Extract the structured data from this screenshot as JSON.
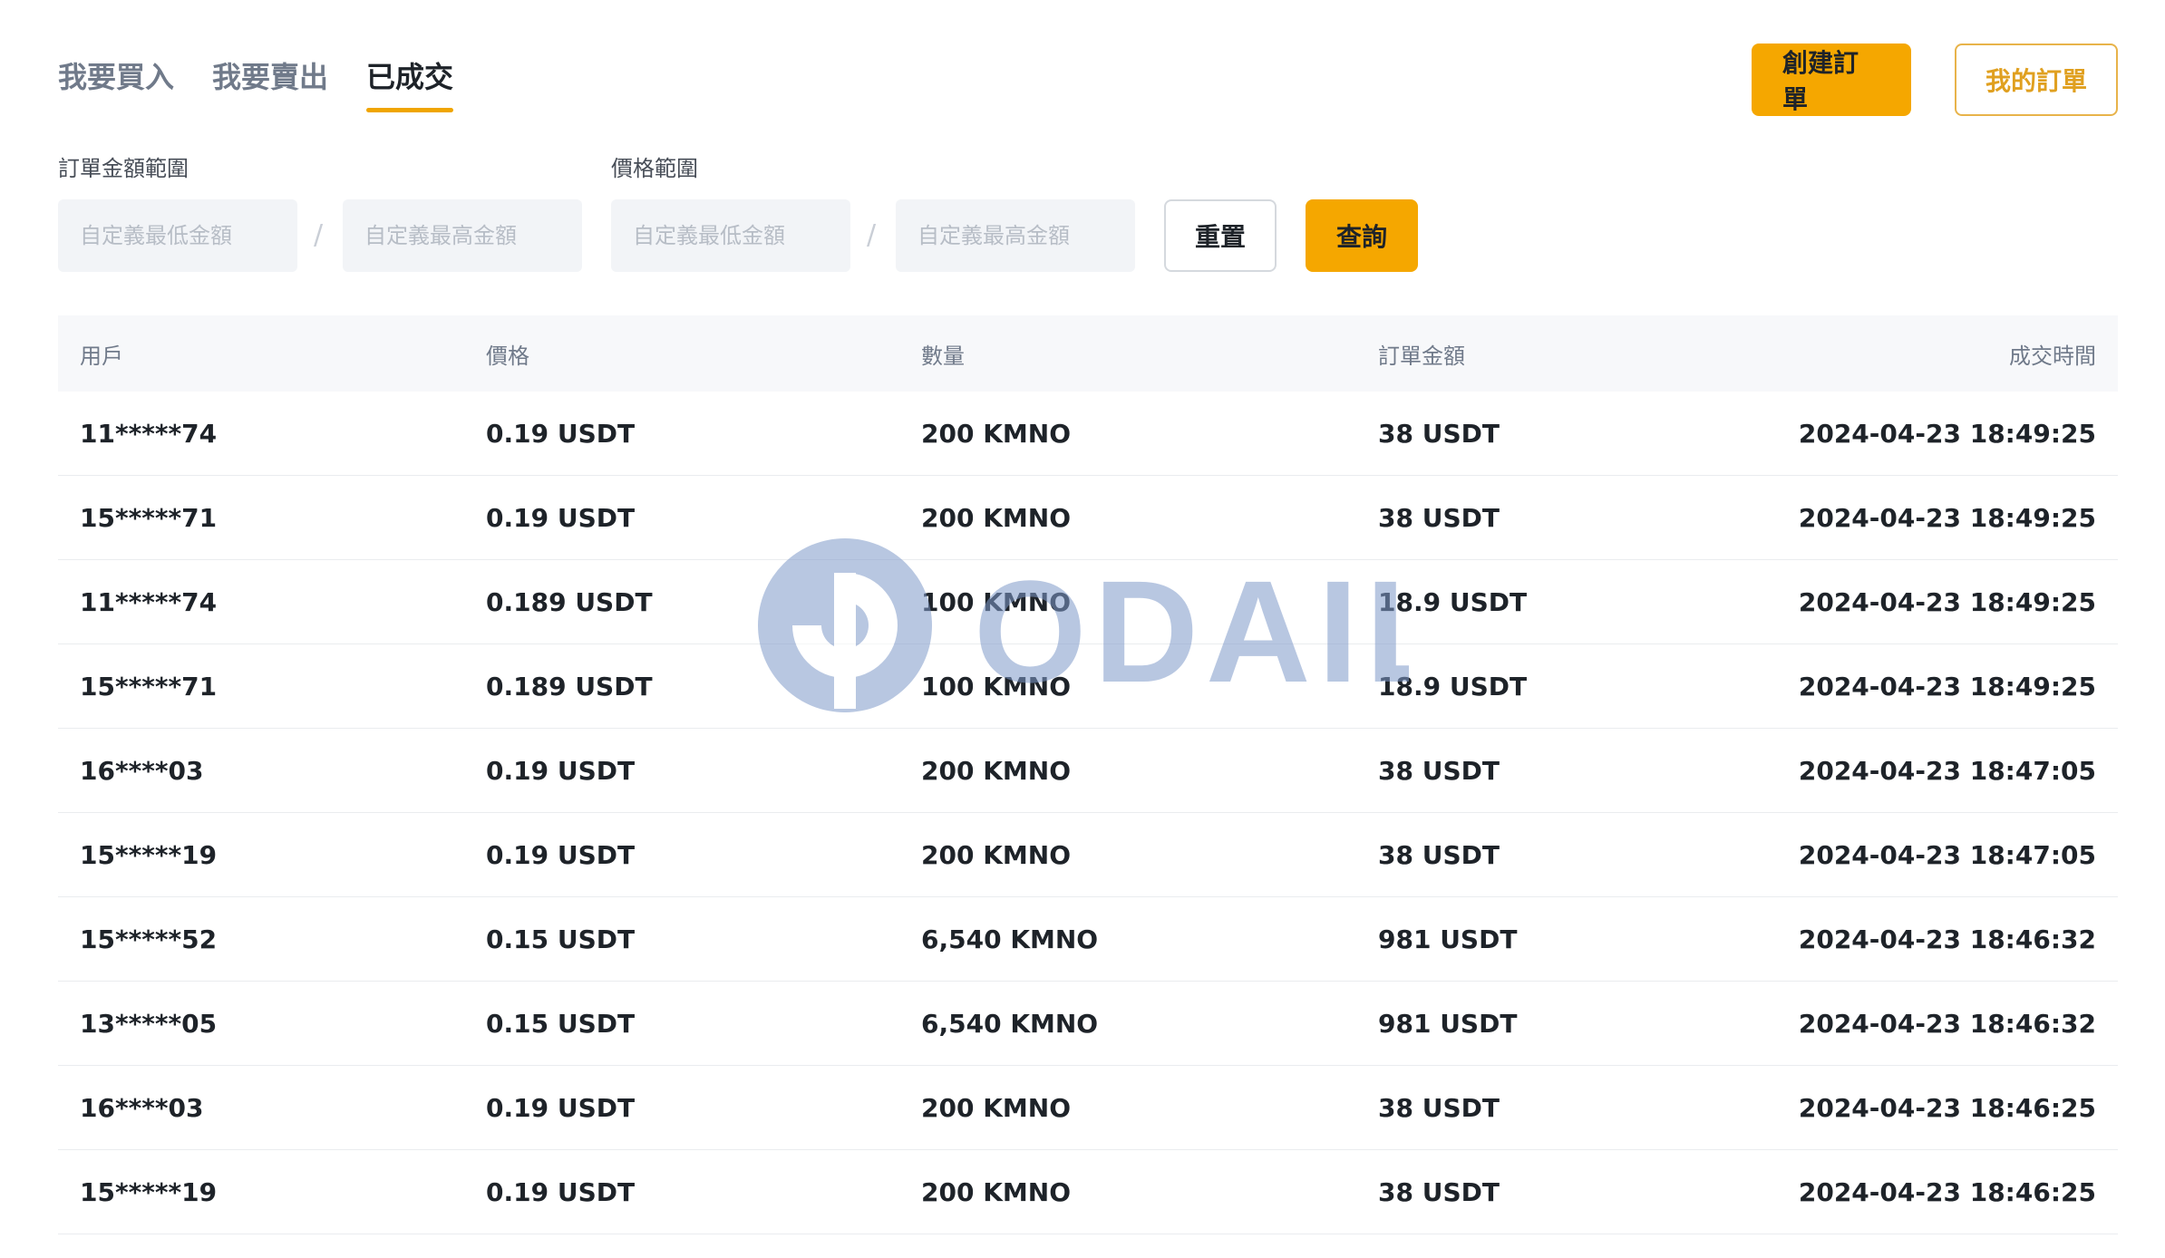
{
  "tabs": [
    {
      "label": "我要買入",
      "active": false
    },
    {
      "label": "我要賣出",
      "active": false
    },
    {
      "label": "已成交",
      "active": true
    }
  ],
  "actions": {
    "create_order": "創建訂單",
    "my_orders": "我的訂單"
  },
  "filters": {
    "amount_label": "訂單金額範圍",
    "price_label": "價格範圍",
    "min_amount_placeholder": "自定義最低金額",
    "max_amount_placeholder": "自定義最高金額",
    "separator": "/",
    "reset": "重置",
    "query": "查詢"
  },
  "table": {
    "headers": [
      "用戶",
      "價格",
      "數量",
      "訂單金額",
      "成交時間"
    ],
    "rows": [
      [
        "11*****74",
        "0.19 USDT",
        "200 KMNO",
        "38 USDT",
        "2024-04-23 18:49:25"
      ],
      [
        "15*****71",
        "0.19 USDT",
        "200 KMNO",
        "38 USDT",
        "2024-04-23 18:49:25"
      ],
      [
        "11*****74",
        "0.189 USDT",
        "100 KMNO",
        "18.9 USDT",
        "2024-04-23 18:49:25"
      ],
      [
        "15*****71",
        "0.189 USDT",
        "100 KMNO",
        "18.9 USDT",
        "2024-04-23 18:49:25"
      ],
      [
        "16****03",
        "0.19 USDT",
        "200 KMNO",
        "38 USDT",
        "2024-04-23 18:47:05"
      ],
      [
        "15*****19",
        "0.19 USDT",
        "200 KMNO",
        "38 USDT",
        "2024-04-23 18:47:05"
      ],
      [
        "15*****52",
        "0.15 USDT",
        "6,540 KMNO",
        "981 USDT",
        "2024-04-23 18:46:32"
      ],
      [
        "13*****05",
        "0.15 USDT",
        "6,540 KMNO",
        "981 USDT",
        "2024-04-23 18:46:32"
      ],
      [
        "16****03",
        "0.19 USDT",
        "200 KMNO",
        "38 USDT",
        "2024-04-23 18:46:25"
      ],
      [
        "15*****19",
        "0.19 USDT",
        "200 KMNO",
        "38 USDT",
        "2024-04-23 18:46:25"
      ]
    ]
  },
  "watermark": {
    "text": "ODAILY",
    "icon": "odaily-logo-icon"
  },
  "colors": {
    "accent": "#f5a700",
    "watermark": "#7f9ac9"
  }
}
